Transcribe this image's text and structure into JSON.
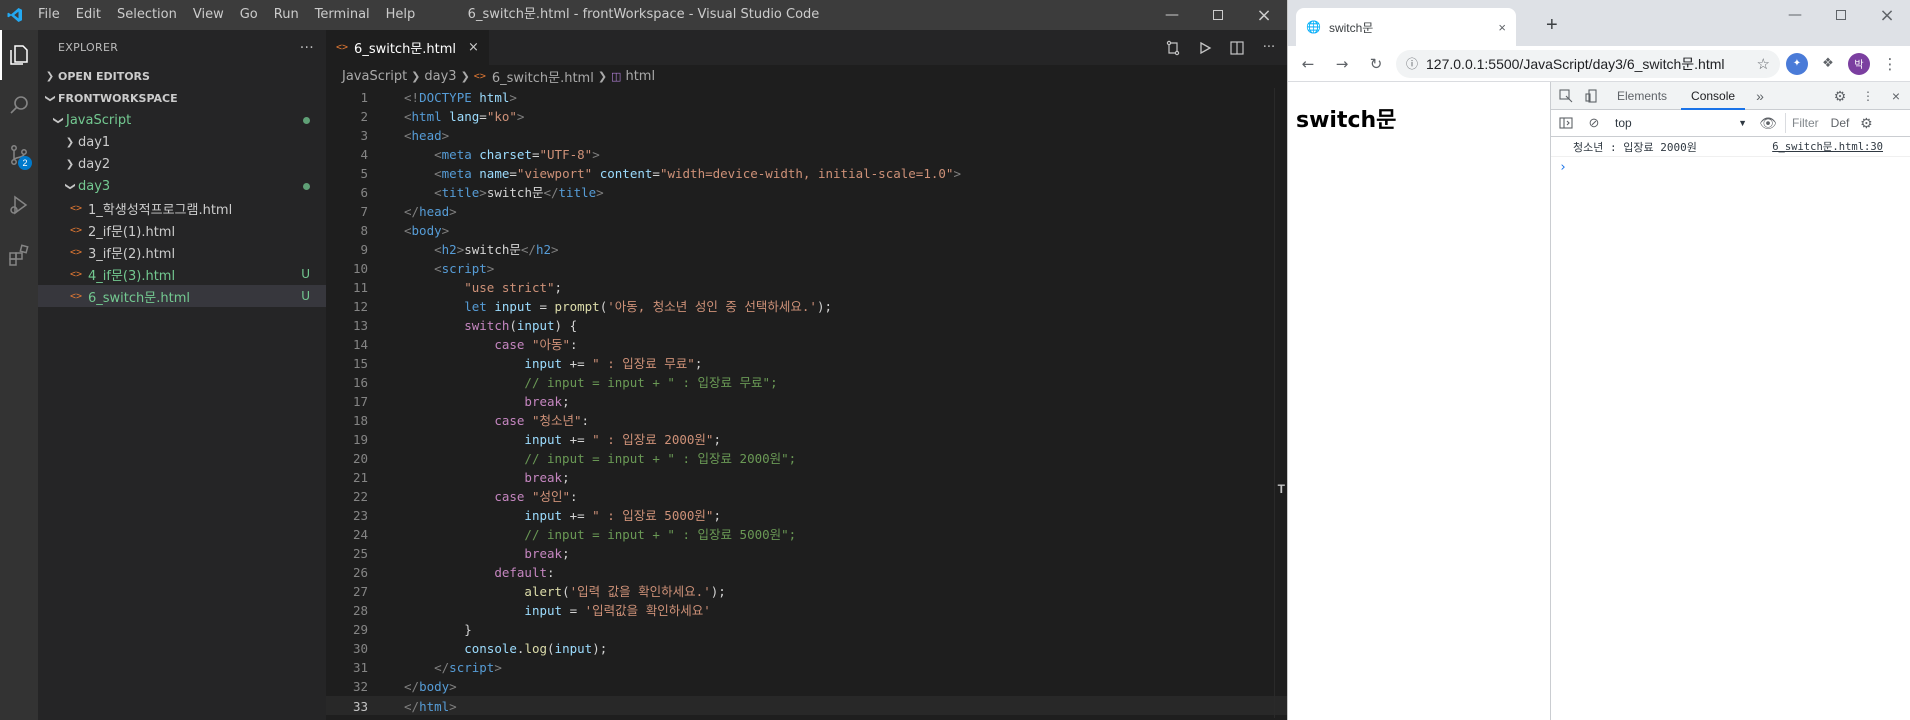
{
  "vscode": {
    "window_title": "6_switch문.html - frontWorkspace - Visual Studio Code",
    "menu": [
      "File",
      "Edit",
      "Selection",
      "View",
      "Go",
      "Run",
      "Terminal",
      "Help"
    ],
    "scm_badge": "2",
    "explorer": {
      "title": "EXPLORER",
      "more": "···",
      "open_editors": "OPEN EDITORS",
      "workspace": "FRONTWORKSPACE",
      "tree": [
        {
          "label": "JavaScript",
          "type": "folder",
          "open": true,
          "status": "dot"
        },
        {
          "label": "day1",
          "type": "folder",
          "open": false
        },
        {
          "label": "day2",
          "type": "folder",
          "open": false
        },
        {
          "label": "day3",
          "type": "folder",
          "open": true,
          "status": "dot"
        },
        {
          "label": "1_학생성적프로그램.html",
          "type": "file"
        },
        {
          "label": "2_if문(1).html",
          "type": "file"
        },
        {
          "label": "3_if문(2).html",
          "type": "file"
        },
        {
          "label": "4_if문(3).html",
          "type": "file",
          "status": "U"
        },
        {
          "label": "6_switch문.html",
          "type": "file",
          "status": "U",
          "selected": true
        }
      ]
    },
    "tab": {
      "label": "6_switch문.html",
      "close": "×"
    },
    "breadcrumbs": [
      "JavaScript",
      "day3",
      "6_switch문.html",
      "html"
    ],
    "code_lines": [
      [
        [
          "t-br",
          "<!"
        ],
        [
          "t-tag",
          "DOCTYPE"
        ],
        [
          "t-txt",
          " "
        ],
        [
          "t-attr",
          "html"
        ],
        [
          "t-br",
          ">"
        ]
      ],
      [
        [
          "t-br",
          "<"
        ],
        [
          "t-tag",
          "html"
        ],
        [
          "t-txt",
          " "
        ],
        [
          "t-attr",
          "lang"
        ],
        [
          "t-txt",
          "="
        ],
        [
          "t-str",
          "\"ko\""
        ],
        [
          "t-br",
          ">"
        ]
      ],
      [
        [
          "t-br",
          "<"
        ],
        [
          "t-tag",
          "head"
        ],
        [
          "t-br",
          ">"
        ]
      ],
      [
        [
          "t-txt",
          "    "
        ],
        [
          "t-br",
          "<"
        ],
        [
          "t-tag",
          "meta"
        ],
        [
          "t-txt",
          " "
        ],
        [
          "t-attr",
          "charset"
        ],
        [
          "t-txt",
          "="
        ],
        [
          "t-str",
          "\"UTF-8\""
        ],
        [
          "t-br",
          ">"
        ]
      ],
      [
        [
          "t-txt",
          "    "
        ],
        [
          "t-br",
          "<"
        ],
        [
          "t-tag",
          "meta"
        ],
        [
          "t-txt",
          " "
        ],
        [
          "t-attr",
          "name"
        ],
        [
          "t-txt",
          "="
        ],
        [
          "t-str",
          "\"viewport\""
        ],
        [
          "t-txt",
          " "
        ],
        [
          "t-attr",
          "content"
        ],
        [
          "t-txt",
          "="
        ],
        [
          "t-str",
          "\"width=device-width, initial-scale=1.0\""
        ],
        [
          "t-br",
          ">"
        ]
      ],
      [
        [
          "t-txt",
          "    "
        ],
        [
          "t-br",
          "<"
        ],
        [
          "t-tag",
          "title"
        ],
        [
          "t-br",
          ">"
        ],
        [
          "t-txt",
          "switch문"
        ],
        [
          "t-br",
          "</"
        ],
        [
          "t-tag",
          "title"
        ],
        [
          "t-br",
          ">"
        ]
      ],
      [
        [
          "t-br",
          "</"
        ],
        [
          "t-tag",
          "head"
        ],
        [
          "t-br",
          ">"
        ]
      ],
      [
        [
          "t-br",
          "<"
        ],
        [
          "t-tag",
          "body"
        ],
        [
          "t-br",
          ">"
        ]
      ],
      [
        [
          "t-txt",
          "    "
        ],
        [
          "t-br",
          "<"
        ],
        [
          "t-tag",
          "h2"
        ],
        [
          "t-br",
          ">"
        ],
        [
          "t-txt",
          "switch문"
        ],
        [
          "t-br",
          "</"
        ],
        [
          "t-tag",
          "h2"
        ],
        [
          "t-br",
          ">"
        ]
      ],
      [
        [
          "t-txt",
          "    "
        ],
        [
          "t-br",
          "<"
        ],
        [
          "t-tag",
          "script"
        ],
        [
          "t-br",
          ">"
        ]
      ],
      [
        [
          "t-txt",
          "        "
        ],
        [
          "t-str",
          "\"use strict\""
        ],
        [
          "t-pn",
          ";"
        ]
      ],
      [
        [
          "t-txt",
          "        "
        ],
        [
          "t-kw2",
          "let"
        ],
        [
          "t-txt",
          " "
        ],
        [
          "t-var",
          "input"
        ],
        [
          "t-pn",
          " = "
        ],
        [
          "t-fn",
          "prompt"
        ],
        [
          "t-pn",
          "("
        ],
        [
          "t-str",
          "'아동, 청소년 성인 중 선택하세요.'"
        ],
        [
          "t-pn",
          ");"
        ]
      ],
      [
        [
          "t-txt",
          "        "
        ],
        [
          "t-kw",
          "switch"
        ],
        [
          "t-pn",
          "("
        ],
        [
          "t-var",
          "input"
        ],
        [
          "t-pn",
          ") {"
        ]
      ],
      [
        [
          "t-txt",
          "            "
        ],
        [
          "t-kw",
          "case"
        ],
        [
          "t-txt",
          " "
        ],
        [
          "t-str",
          "\"아동\""
        ],
        [
          "t-pn",
          ":"
        ]
      ],
      [
        [
          "t-txt",
          "                "
        ],
        [
          "t-var",
          "input"
        ],
        [
          "t-pn",
          " += "
        ],
        [
          "t-str",
          "\" : 입장료 무료\""
        ],
        [
          "t-pn",
          ";"
        ]
      ],
      [
        [
          "t-txt",
          "                "
        ],
        [
          "t-com",
          "// input = input + \" : 입장료 무료\";"
        ]
      ],
      [
        [
          "t-txt",
          "                "
        ],
        [
          "t-kw",
          "break"
        ],
        [
          "t-pn",
          ";"
        ]
      ],
      [
        [
          "t-txt",
          "            "
        ],
        [
          "t-kw",
          "case"
        ],
        [
          "t-txt",
          " "
        ],
        [
          "t-str",
          "\"청소년\""
        ],
        [
          "t-pn",
          ":"
        ]
      ],
      [
        [
          "t-txt",
          "                "
        ],
        [
          "t-var",
          "input"
        ],
        [
          "t-pn",
          " += "
        ],
        [
          "t-str",
          "\" : 입장료 2000원\""
        ],
        [
          "t-pn",
          ";"
        ]
      ],
      [
        [
          "t-txt",
          "                "
        ],
        [
          "t-com",
          "// input = input + \" : 입장료 2000원\";"
        ]
      ],
      [
        [
          "t-txt",
          "                "
        ],
        [
          "t-kw",
          "break"
        ],
        [
          "t-pn",
          ";"
        ]
      ],
      [
        [
          "t-txt",
          "            "
        ],
        [
          "t-kw",
          "case"
        ],
        [
          "t-txt",
          " "
        ],
        [
          "t-str",
          "\"성인\""
        ],
        [
          "t-pn",
          ":"
        ]
      ],
      [
        [
          "t-txt",
          "                "
        ],
        [
          "t-var",
          "input"
        ],
        [
          "t-pn",
          " += "
        ],
        [
          "t-str",
          "\" : 입장료 5000원\""
        ],
        [
          "t-pn",
          ";"
        ]
      ],
      [
        [
          "t-txt",
          "                "
        ],
        [
          "t-com",
          "// input = input + \" : 입장료 5000원\";"
        ]
      ],
      [
        [
          "t-txt",
          "                "
        ],
        [
          "t-kw",
          "break"
        ],
        [
          "t-pn",
          ";"
        ]
      ],
      [
        [
          "t-txt",
          "            "
        ],
        [
          "t-kw",
          "default"
        ],
        [
          "t-pn",
          ":"
        ]
      ],
      [
        [
          "t-txt",
          "                "
        ],
        [
          "t-fn",
          "alert"
        ],
        [
          "t-pn",
          "("
        ],
        [
          "t-str",
          "'입력 값을 확인하세요.'"
        ],
        [
          "t-pn",
          ");"
        ]
      ],
      [
        [
          "t-txt",
          "                "
        ],
        [
          "t-var",
          "input"
        ],
        [
          "t-pn",
          " = "
        ],
        [
          "t-str",
          "'입력값을 확인하세요'"
        ]
      ],
      [
        [
          "t-txt",
          "        "
        ],
        [
          "t-pn",
          "}"
        ]
      ],
      [
        [
          "t-txt",
          "        "
        ],
        [
          "t-var",
          "console"
        ],
        [
          "t-pn",
          "."
        ],
        [
          "t-fn",
          "log"
        ],
        [
          "t-pn",
          "("
        ],
        [
          "t-var",
          "input"
        ],
        [
          "t-pn",
          ");"
        ]
      ],
      [
        [
          "t-txt",
          "    "
        ],
        [
          "t-br",
          "</"
        ],
        [
          "t-tag",
          "script"
        ],
        [
          "t-br",
          ">"
        ]
      ],
      [
        [
          "t-br",
          "</"
        ],
        [
          "t-tag",
          "body"
        ],
        [
          "t-br",
          ">"
        ]
      ],
      [
        [
          "t-br",
          "</"
        ],
        [
          "t-tag",
          "html"
        ],
        [
          "t-br",
          ">"
        ]
      ]
    ],
    "current_line": 33,
    "scroll_marker": "T"
  },
  "chrome": {
    "tab_title": "switch문",
    "tab_close": "×",
    "new_tab": "+",
    "url": "127.0.0.1:5500/JavaScript/day3/6_switch문.html",
    "profile_initial": "박",
    "page_heading": "switch문",
    "devtools": {
      "tabs": [
        "Elements",
        "Console"
      ],
      "active_tab": "Console",
      "more_tabs": "»",
      "context": "top",
      "filter_placeholder": "Filter",
      "levels": "Def",
      "console_message": "청소년 : 입장료 2000원",
      "console_source": "6_switch문.html:30",
      "prompt": "›"
    }
  }
}
